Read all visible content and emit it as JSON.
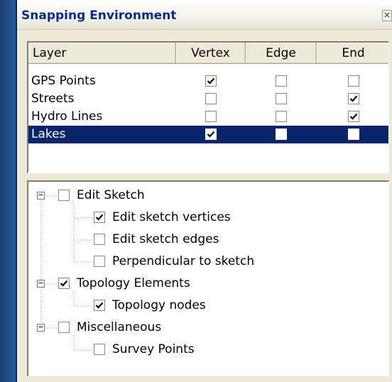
{
  "window": {
    "title": "Snapping Environment",
    "close_glyph": "×"
  },
  "columns": {
    "layer": "Layer",
    "vertex": "Vertex",
    "edge": "Edge",
    "end": "End"
  },
  "layers": [
    {
      "name": "GPS Points",
      "vertex": true,
      "edge": false,
      "end": false,
      "selected": false
    },
    {
      "name": "Streets",
      "vertex": false,
      "edge": false,
      "end": true,
      "selected": false
    },
    {
      "name": "Hydro Lines",
      "vertex": false,
      "edge": false,
      "end": true,
      "selected": false
    },
    {
      "name": "Lakes",
      "vertex": true,
      "edge": false,
      "end": false,
      "selected": true
    }
  ],
  "tree": [
    {
      "label": "Edit Sketch",
      "checked": false,
      "expander": "−",
      "children": [
        {
          "label": "Edit sketch vertices",
          "checked": true
        },
        {
          "label": "Edit sketch edges",
          "checked": false
        },
        {
          "label": "Perpendicular to sketch",
          "checked": false
        }
      ]
    },
    {
      "label": "Topology Elements",
      "checked": true,
      "expander": "−",
      "children": [
        {
          "label": "Topology nodes",
          "checked": true
        }
      ]
    },
    {
      "label": "Miscellaneous",
      "checked": false,
      "expander": "−",
      "children": [
        {
          "label": "Survey Points",
          "checked": false
        }
      ]
    }
  ],
  "icons": {
    "check": "check-icon",
    "close": "close-icon",
    "expander": "minus-box-icon"
  },
  "colors": {
    "selection": "#0a246a",
    "title_text": "#0b2d84",
    "window_face": "#ece9d8",
    "desktop": "#1f4f86"
  }
}
